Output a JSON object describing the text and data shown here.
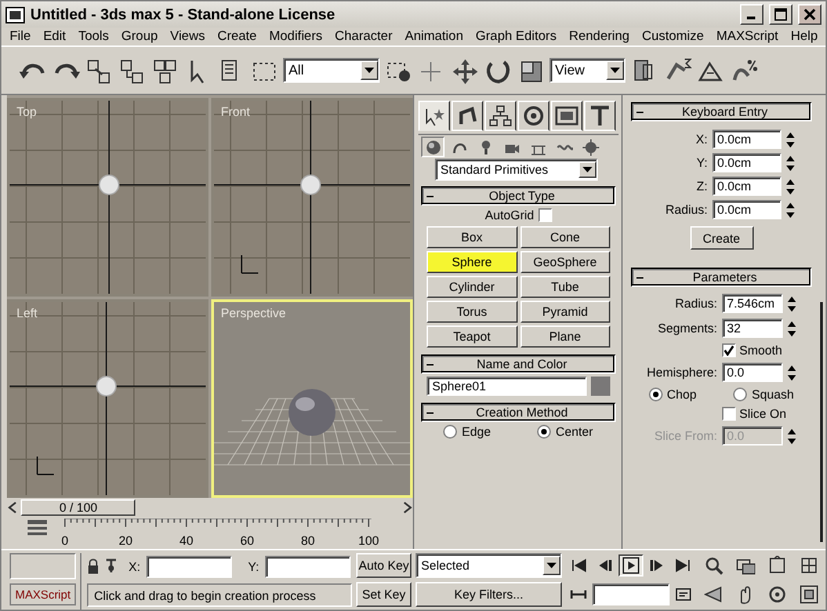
{
  "window": {
    "title": "Untitled - 3ds max 5 - Stand-alone License"
  },
  "menu": [
    "File",
    "Edit",
    "Tools",
    "Group",
    "Views",
    "Create",
    "Modifiers",
    "Character",
    "Animation",
    "Graph Editors",
    "Rendering",
    "Customize",
    "MAXScript",
    "Help"
  ],
  "toolbar": {
    "selection_filter": "All",
    "reference_coord": "View"
  },
  "viewports": [
    {
      "label": "Top",
      "kind": "ortho",
      "active": false
    },
    {
      "label": "Front",
      "kind": "ortho",
      "active": false
    },
    {
      "label": "Left",
      "kind": "ortho",
      "active": false
    },
    {
      "label": "Perspective",
      "kind": "perspective",
      "active": true
    }
  ],
  "command_panel": {
    "tabs": [
      {
        "selected": true
      },
      {
        "selected": false
      },
      {
        "selected": false
      },
      {
        "selected": false
      },
      {
        "selected": false
      },
      {
        "selected": false
      }
    ],
    "subtabs": [
      {
        "selected": true
      },
      {
        "selected": false
      },
      {
        "selected": false
      },
      {
        "selected": false
      },
      {
        "selected": false
      },
      {
        "selected": false
      },
      {
        "selected": false
      }
    ],
    "category": "Standard Primitives",
    "object_type": {
      "title": "Object Type",
      "autogrid": {
        "label": "AutoGrid",
        "checked": false
      },
      "buttons": [
        {
          "label": "Box",
          "selected": false
        },
        {
          "label": "Cone",
          "selected": false
        },
        {
          "label": "Sphere",
          "selected": true
        },
        {
          "label": "GeoSphere",
          "selected": false
        },
        {
          "label": "Cylinder",
          "selected": false
        },
        {
          "label": "Tube",
          "selected": false
        },
        {
          "label": "Torus",
          "selected": false
        },
        {
          "label": "Pyramid",
          "selected": false
        },
        {
          "label": "Teapot",
          "selected": false
        },
        {
          "label": "Plane",
          "selected": false
        }
      ]
    },
    "name_color": {
      "title": "Name and Color",
      "name": "Sphere01",
      "color": "#7a7878"
    },
    "creation_method": {
      "title": "Creation Method",
      "options": [
        {
          "label": "Edge",
          "selected": false
        },
        {
          "label": "Center",
          "selected": true
        }
      ]
    },
    "keyboard_entry": {
      "title": "Keyboard Entry",
      "fields": [
        {
          "label": "X:",
          "value": "0.0cm"
        },
        {
          "label": "Y:",
          "value": "0.0cm"
        },
        {
          "label": "Z:",
          "value": "0.0cm"
        },
        {
          "label": "Radius:",
          "value": "0.0cm"
        }
      ],
      "button": "Create"
    },
    "parameters": {
      "title": "Parameters",
      "radius": {
        "label": "Radius:",
        "value": "7.546cm"
      },
      "segments": {
        "label": "Segments:",
        "value": "32"
      },
      "smooth": {
        "label": "Smooth",
        "checked": true
      },
      "hemisphere": {
        "label": "Hemisphere:",
        "value": "0.0"
      },
      "modes": [
        {
          "label": "Chop",
          "selected": true
        },
        {
          "label": "Squash",
          "selected": false
        }
      ],
      "slice_on": {
        "label": "Slice On",
        "checked": false
      },
      "slice_from": {
        "label": "Slice From:",
        "value": "0.0",
        "disabled": true
      }
    }
  },
  "timeline": {
    "frame": "0 / 100",
    "level": 0,
    "ticks": [
      "0",
      "20",
      "40",
      "60",
      "80",
      "100"
    ]
  },
  "status": {
    "maxscript": "MAXScript",
    "prompt": "Click and drag to begin creation process",
    "x_label": "X:",
    "y_label": "Y:"
  },
  "animation": {
    "auto_key": "Auto Key",
    "set_key": "Set Key",
    "key_mode": "Selected",
    "key_filters": "Key Filters...",
    "play_selected": true
  }
}
